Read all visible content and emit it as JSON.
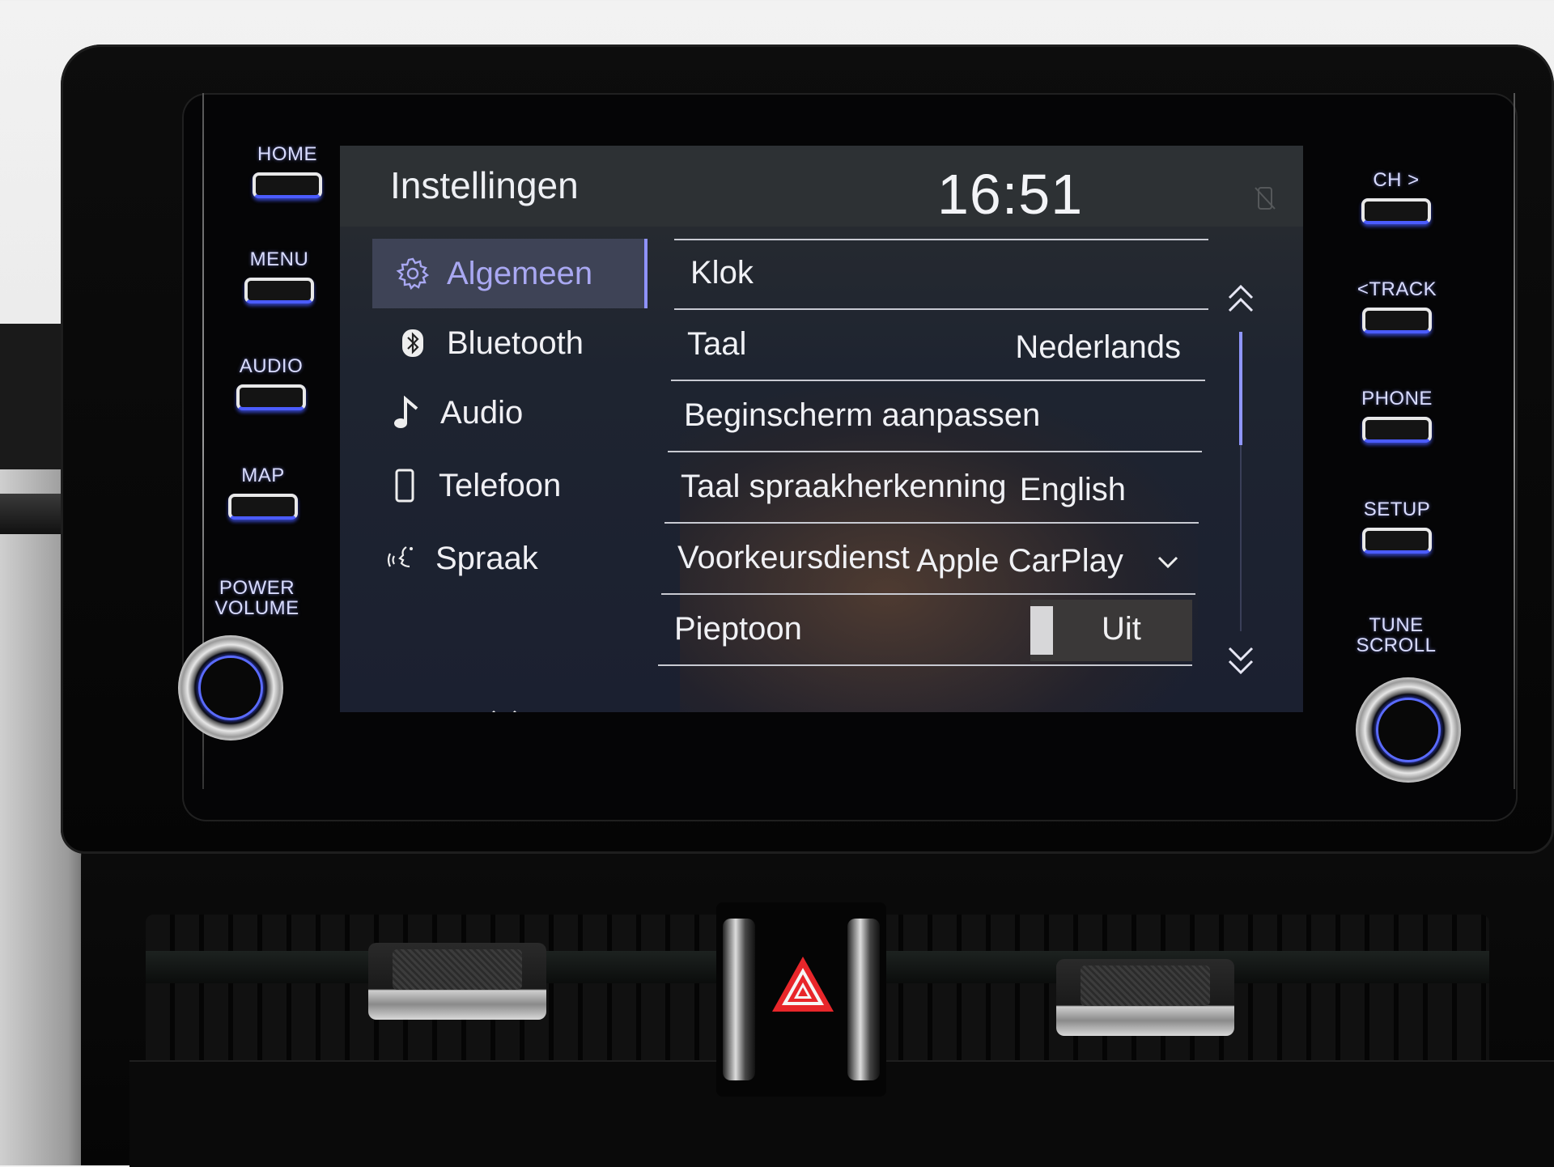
{
  "screen": {
    "title": "Instellingen",
    "clock": "16:51",
    "status_icon": "no-phone-icon"
  },
  "sidebar": {
    "items": [
      {
        "label": "Algemeen",
        "icon": "gear-icon",
        "active": true
      },
      {
        "label": "Bluetooth",
        "icon": "bluetooth-icon",
        "active": false
      },
      {
        "label": "Audio",
        "icon": "music-note-icon",
        "active": false
      },
      {
        "label": "Telefoon",
        "icon": "phone-icon",
        "active": false
      },
      {
        "label": "Spraak",
        "icon": "voice-icon",
        "active": false
      }
    ],
    "more_icon": "chevron-down-icon"
  },
  "settings": {
    "rows": [
      {
        "label": "Klok",
        "value": ""
      },
      {
        "label": "Taal",
        "value": "Nederlands"
      },
      {
        "label": "Beginscherm aanpassen",
        "value": ""
      },
      {
        "label": "Taal spraakherkenning",
        "value": "English"
      },
      {
        "label": "Voorkeursdienst",
        "value": "Apple CarPlay",
        "dropdown": true
      },
      {
        "label": "Pieptoon",
        "value": "Uit",
        "toggle": true,
        "toggle_on": false
      }
    ],
    "scroll_position": 0.0
  },
  "hardware_buttons": {
    "left": [
      "HOME",
      "MENU",
      "AUDIO",
      "MAP"
    ],
    "left_knob_label_line1": "POWER",
    "left_knob_label_line2": "VOLUME",
    "right": [
      "CH >",
      "<TRACK",
      "PHONE",
      "SETUP"
    ],
    "right_knob_label_line1": "TUNE",
    "right_knob_label_line2": "SCROLL"
  },
  "colors": {
    "accent": "#8f92ff",
    "active_bg": "#3e4356",
    "button_glow": "#4b5cff",
    "hazard": "#e8262a"
  }
}
